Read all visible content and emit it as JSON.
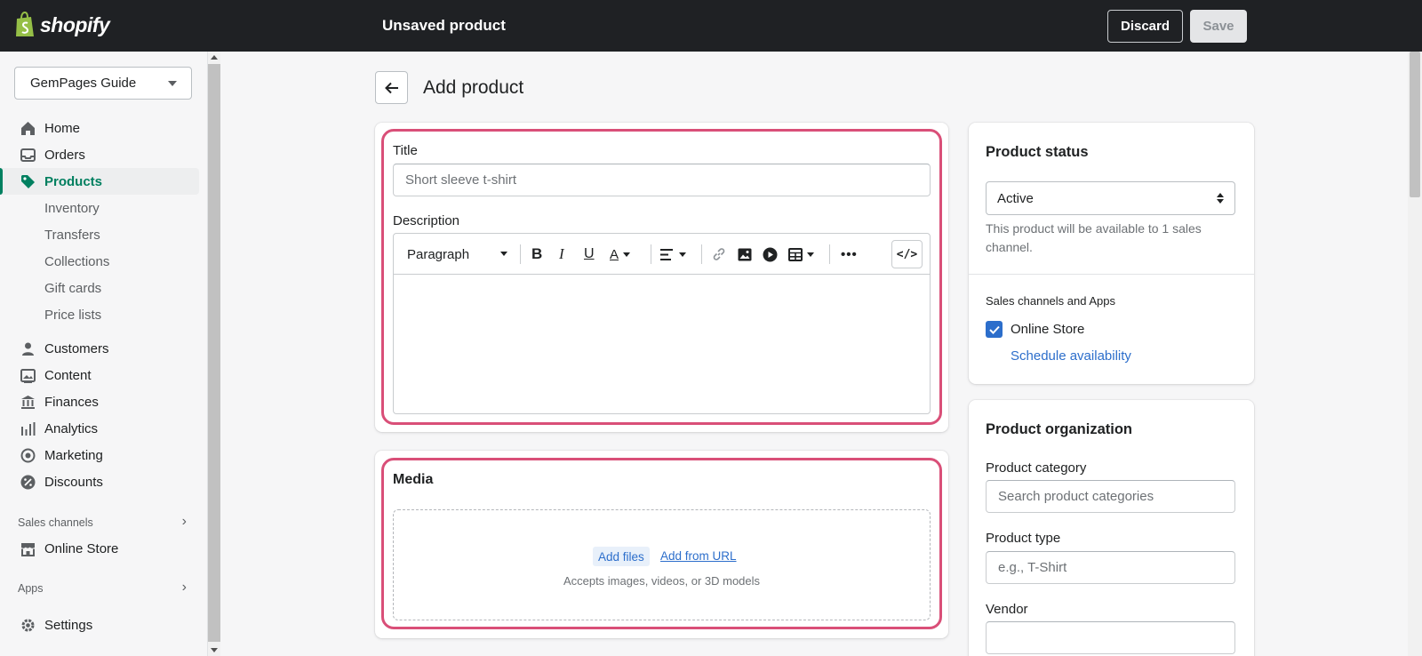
{
  "topbar": {
    "brand": "shopify",
    "title": "Unsaved product",
    "discard_label": "Discard",
    "save_label": "Save"
  },
  "sidebar": {
    "store_name": "GemPages Guide",
    "items": [
      {
        "label": "Home",
        "icon": "home-icon"
      },
      {
        "label": "Orders",
        "icon": "orders-icon"
      },
      {
        "label": "Products",
        "icon": "tag-icon",
        "active": true
      },
      {
        "label": "Inventory"
      },
      {
        "label": "Transfers"
      },
      {
        "label": "Collections"
      },
      {
        "label": "Gift cards"
      },
      {
        "label": "Price lists"
      },
      {
        "label": "Customers",
        "icon": "person-icon"
      },
      {
        "label": "Content",
        "icon": "content-icon"
      },
      {
        "label": "Finances",
        "icon": "bank-icon"
      },
      {
        "label": "Analytics",
        "icon": "bar-chart-icon"
      },
      {
        "label": "Marketing",
        "icon": "target-icon"
      },
      {
        "label": "Discounts",
        "icon": "discount-icon"
      }
    ],
    "sales_channels_label": "Sales channels",
    "online_store_label": "Online Store",
    "apps_label": "Apps",
    "settings_label": "Settings"
  },
  "page": {
    "title": "Add product"
  },
  "product_form": {
    "title_label": "Title",
    "title_placeholder": "Short sleeve t-shirt",
    "description_label": "Description",
    "paragraph_label": "Paragraph"
  },
  "media": {
    "heading": "Media",
    "add_files": "Add files",
    "add_from_url": "Add from URL",
    "hint": "Accepts images, videos, or 3D models"
  },
  "status_card": {
    "heading": "Product status",
    "status_value": "Active",
    "help_text": "This product will be available to 1 sales channel.",
    "channels_heading": "Sales channels and Apps",
    "online_store": "Online Store",
    "schedule_link": "Schedule availability"
  },
  "organization": {
    "heading": "Product organization",
    "category_label": "Product category",
    "category_placeholder": "Search product categories",
    "type_label": "Product type",
    "type_placeholder": "e.g., T-Shirt",
    "vendor_label": "Vendor"
  },
  "colors": {
    "highlight": "#d94f78",
    "accent_green": "#008060",
    "link_blue": "#2c6ecb",
    "topbar": "#1f2124"
  }
}
